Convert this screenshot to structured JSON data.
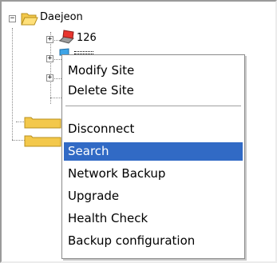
{
  "tree": {
    "root": {
      "label": "Daejeon",
      "expander": "−",
      "icon": "folder-open-icon"
    },
    "child_first": {
      "label": "126",
      "expander": "+",
      "icon": "computer-alert-icon"
    },
    "collapsed_expanders": [
      "+",
      "+",
      "+"
    ]
  },
  "context_menu": {
    "items": [
      {
        "label": "Modify Site",
        "selected": false
      },
      {
        "label": "Delete Site",
        "selected": false
      },
      {
        "label": "Disconnect",
        "selected": false
      },
      {
        "label": "Search",
        "selected": true
      },
      {
        "label": "Network Backup",
        "selected": false
      },
      {
        "label": "Upgrade",
        "selected": false
      },
      {
        "label": "Health Check",
        "selected": false
      },
      {
        "label": "Backup configuration",
        "selected": false
      }
    ]
  },
  "colors": {
    "selection_background": "#316ac5",
    "selection_text": "#ffffff",
    "folder": "#f3c84b",
    "alert_computer": "#e8352f"
  }
}
